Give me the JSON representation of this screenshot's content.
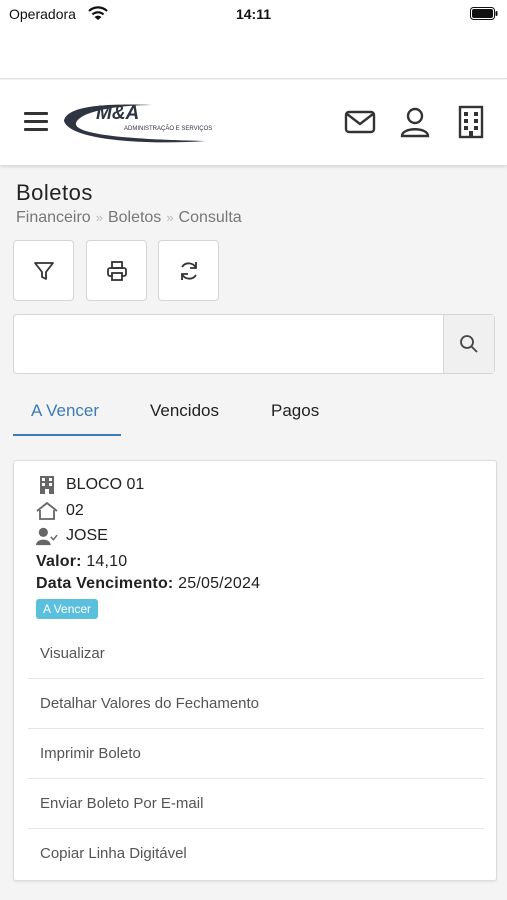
{
  "status_bar": {
    "carrier": "Operadora",
    "time": "14:11"
  },
  "header": {
    "logo_text": "M&A",
    "logo_subtext": "ADMINISTRAÇÃO E SERVIÇOS",
    "icons": [
      "menu-icon",
      "mail-icon",
      "user-icon",
      "building-icon"
    ]
  },
  "page": {
    "title": "Boletos",
    "breadcrumb": [
      "Financeiro",
      "Boletos",
      "Consulta"
    ],
    "breadcrumb_sep": "»"
  },
  "toolbar": {
    "icons": [
      "filter-icon",
      "print-icon",
      "refresh-icon"
    ]
  },
  "search": {
    "value": "",
    "placeholder": ""
  },
  "tabs": [
    {
      "label": "A Vencer",
      "active": true
    },
    {
      "label": "Vencidos",
      "active": false
    },
    {
      "label": "Pagos",
      "active": false
    }
  ],
  "boleto": {
    "bloco": "BLOCO 01",
    "unidade": "02",
    "morador": "JOSE",
    "valor_label": "Valor:",
    "valor": "14,10",
    "vencimento_label": "Data Vencimento:",
    "vencimento": "25/05/2024",
    "status": "A Vencer",
    "actions": [
      "Visualizar",
      "Detalhar Valores do Fechamento",
      "Imprimir Boleto",
      "Enviar Boleto Por E-mail",
      "Copiar Linha Digitável"
    ]
  },
  "colors": {
    "accent": "#3c7bb5",
    "badge": "#5bc0de"
  }
}
